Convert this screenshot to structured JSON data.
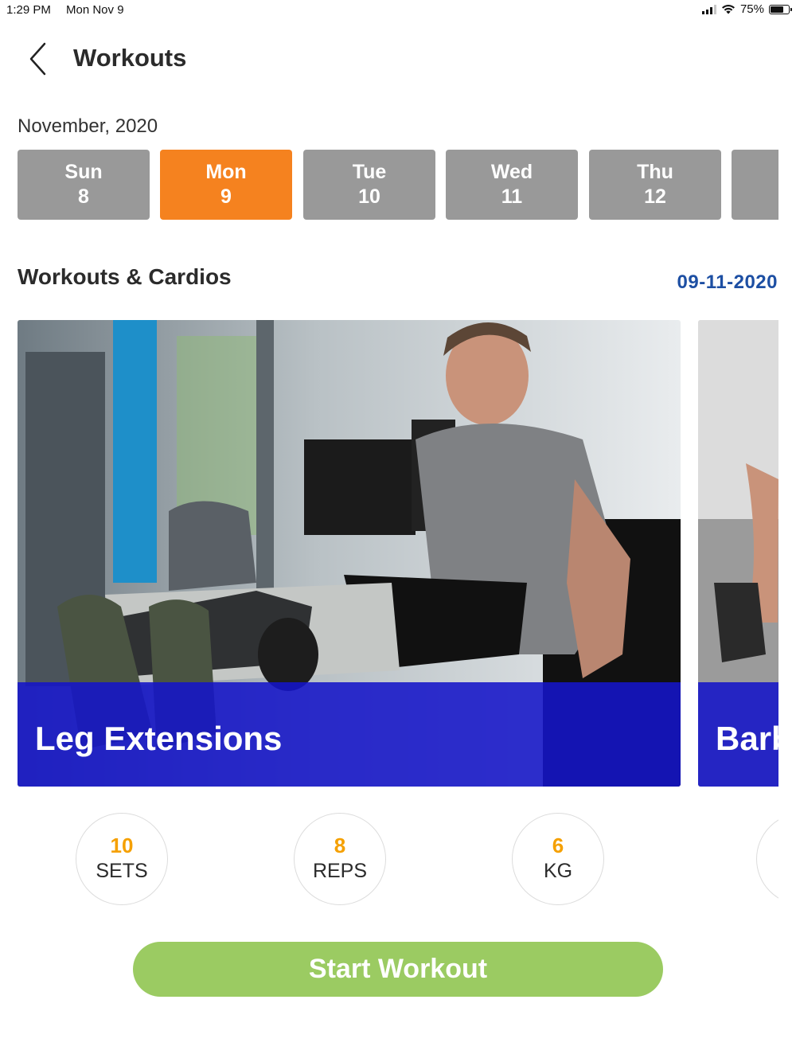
{
  "status_bar": {
    "time": "1:29 PM",
    "date": "Mon Nov 9",
    "battery": "75%",
    "battery_level": 0.75
  },
  "header": {
    "back_icon": "chevron-left-icon",
    "title": "Workouts"
  },
  "calendar": {
    "month": "November, 2020",
    "days": [
      {
        "weekday": "Sun",
        "day": "8",
        "selected": false
      },
      {
        "weekday": "Mon",
        "day": "9",
        "selected": true
      },
      {
        "weekday": "Tue",
        "day": "10",
        "selected": false
      },
      {
        "weekday": "Wed",
        "day": "11",
        "selected": false
      },
      {
        "weekday": "Thu",
        "day": "12",
        "selected": false
      }
    ]
  },
  "section": {
    "title": "Workouts & Cardios",
    "date": "09-11-2020"
  },
  "workouts": [
    {
      "name": "Leg Extensions"
    },
    {
      "name": "Barb"
    }
  ],
  "stats": [
    {
      "value": "10",
      "unit": "SETS"
    },
    {
      "value": "8",
      "unit": "REPS"
    },
    {
      "value": "6",
      "unit": "KG"
    }
  ],
  "actions": {
    "start_label": "Start Workout"
  },
  "colors": {
    "selected_day": "#f5821f",
    "day": "#999999",
    "overlay": "#1414c8",
    "stat_value": "#f5a000",
    "section_date": "#1d4fa3",
    "start_button": "#9bcb62"
  }
}
